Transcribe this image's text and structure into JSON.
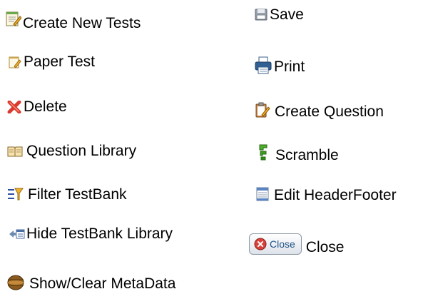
{
  "left": {
    "create_new_tests": "Create New Tests",
    "paper_test": "Paper Test",
    "delete": "Delete",
    "question_library": "Question Library",
    "filter_testbank": "Filter TestBank",
    "hide_testbank_library": "Hide TestBank Library",
    "show_clear_metadata": "Show/Clear MetaData"
  },
  "right": {
    "save": "Save",
    "print": "Print",
    "create_question": "Create Question",
    "scramble": "Scramble",
    "edit_headerfooter": "Edit HeaderFooter",
    "close_button_text": "Close",
    "close": "Close"
  },
  "icons": {
    "create_new_tests": "notepad-pencil-icon",
    "paper_test": "paper-pencil-icon",
    "delete": "red-x-icon",
    "question_library": "open-book-icon",
    "filter_testbank": "filter-icon",
    "hide_testbank_library": "hide-panel-icon",
    "show_clear_metadata": "metadata-disc-icon",
    "save": "floppy-icon",
    "print": "printer-icon",
    "create_question": "clipboard-pencil-icon",
    "scramble": "scramble-icon",
    "edit_headerfooter": "document-edit-icon",
    "close": "close-circle-icon"
  }
}
